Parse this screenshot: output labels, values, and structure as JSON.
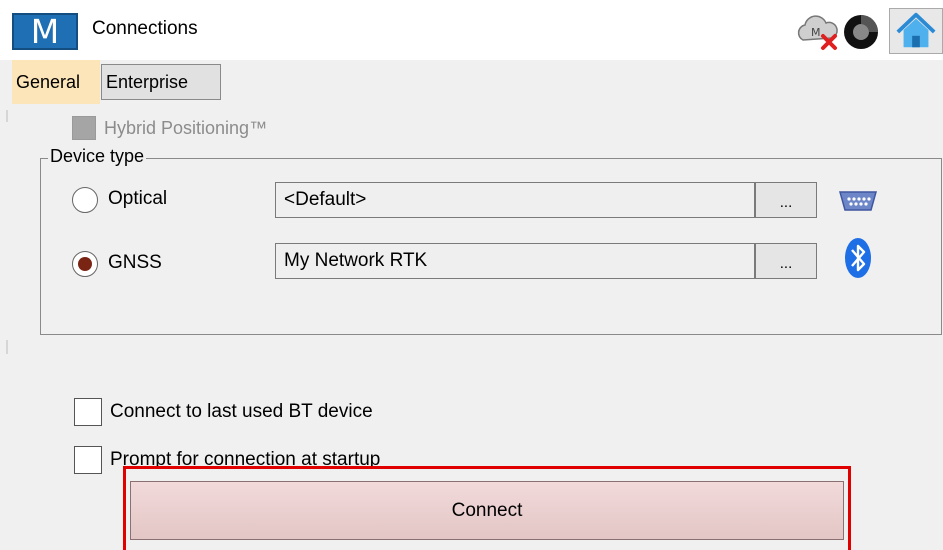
{
  "header": {
    "logo_text": "M",
    "title": "Connections",
    "cloud_badge": "M"
  },
  "tabs": [
    {
      "label": "General",
      "active": true
    },
    {
      "label": "Enterprise",
      "active": false
    }
  ],
  "hybrid": {
    "label": "Hybrid Positioning™",
    "checked": false,
    "disabled": true
  },
  "device_type": {
    "legend": "Device type",
    "options": [
      {
        "label": "Optical",
        "selected": false,
        "value": "<Default>",
        "browse_label": "...",
        "icon": "serial-port-icon"
      },
      {
        "label": "GNSS",
        "selected": true,
        "value": "My Network RTK",
        "browse_label": "...",
        "icon": "bluetooth-icon"
      }
    ]
  },
  "options": [
    {
      "label": "Connect to last used BT device",
      "checked": false
    },
    {
      "label": "Prompt for connection at startup",
      "checked": false
    }
  ],
  "connect_label": "Connect",
  "colors": {
    "accent": "#1f6fb5",
    "active_tab": "#fce5b8",
    "highlight_border": "#e00000",
    "connect_button": "#ecd2d2"
  }
}
